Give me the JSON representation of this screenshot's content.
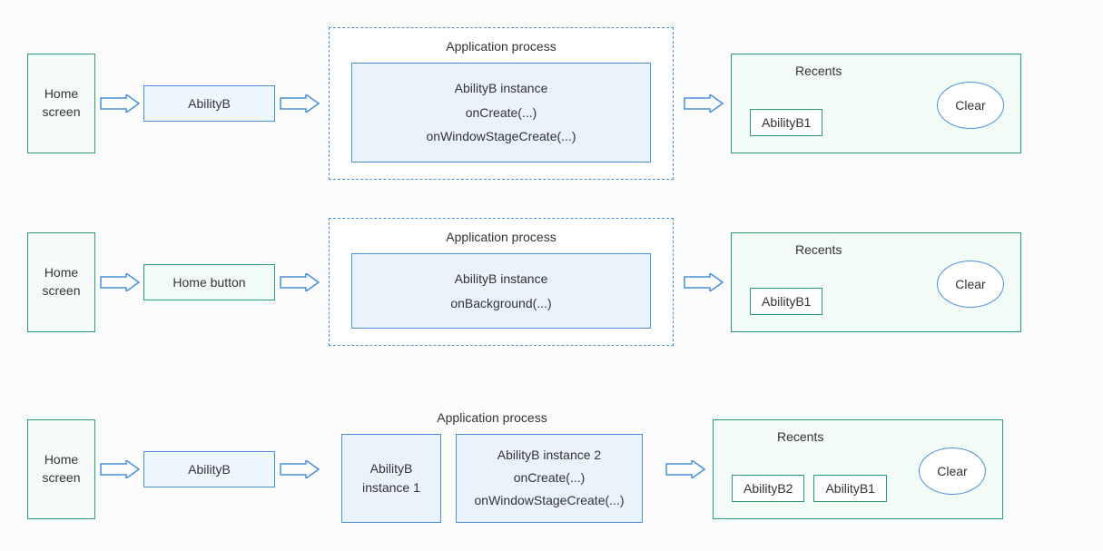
{
  "rows": [
    {
      "home": "Home screen",
      "action": "AbilityB",
      "actionStyle": "blue",
      "processTitle": "Application process",
      "container": "dashed",
      "instances": {
        "type": "single",
        "lines": [
          "AbilityB instance",
          "onCreate(...)",
          "onWindowStageCreate(...)"
        ]
      },
      "recents": {
        "title": "Recents",
        "items": [
          "AbilityB1"
        ],
        "clear": "Clear"
      }
    },
    {
      "home": "Home screen",
      "action": "Home button",
      "actionStyle": "green",
      "processTitle": "Application process",
      "container": "dashed",
      "instances": {
        "type": "single",
        "lines": [
          "AbilityB instance",
          "onBackground(...)"
        ]
      },
      "recents": {
        "title": "Recents",
        "items": [
          "AbilityB1"
        ],
        "clear": "Clear"
      }
    },
    {
      "home": "Home screen",
      "action": "AbilityB",
      "actionStyle": "blue",
      "processTitle": "Application process",
      "container": "plain",
      "instances": {
        "type": "pair",
        "left": "AbilityB instance 1",
        "rightLines": [
          "AbilityB instance 2",
          "onCreate(...)",
          "onWindowStageCreate(...)"
        ]
      },
      "recents": {
        "title": "Recents",
        "items": [
          "AbilityB2",
          "AbilityB1"
        ],
        "clear": "Clear"
      }
    }
  ]
}
